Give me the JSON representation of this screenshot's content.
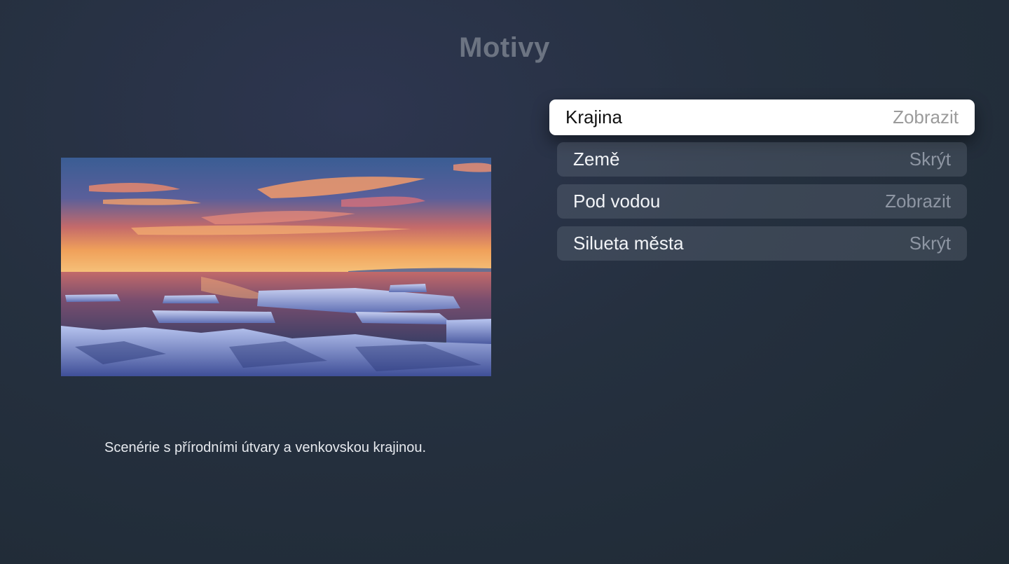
{
  "title": "Motivy",
  "description": "Scenérie s přírodními útvary a venkovskou krajinou.",
  "menu": {
    "items": [
      {
        "label": "Krajina",
        "value": "Zobrazit",
        "focused": true
      },
      {
        "label": "Země",
        "value": "Skrýt",
        "focused": false
      },
      {
        "label": "Pod vodou",
        "value": "Zobrazit",
        "focused": false
      },
      {
        "label": "Silueta města",
        "value": "Skrýt",
        "focused": false
      }
    ]
  },
  "colors": {
    "background": "#25303f",
    "focused_item": "#ffffff",
    "title": "#6c7482"
  }
}
